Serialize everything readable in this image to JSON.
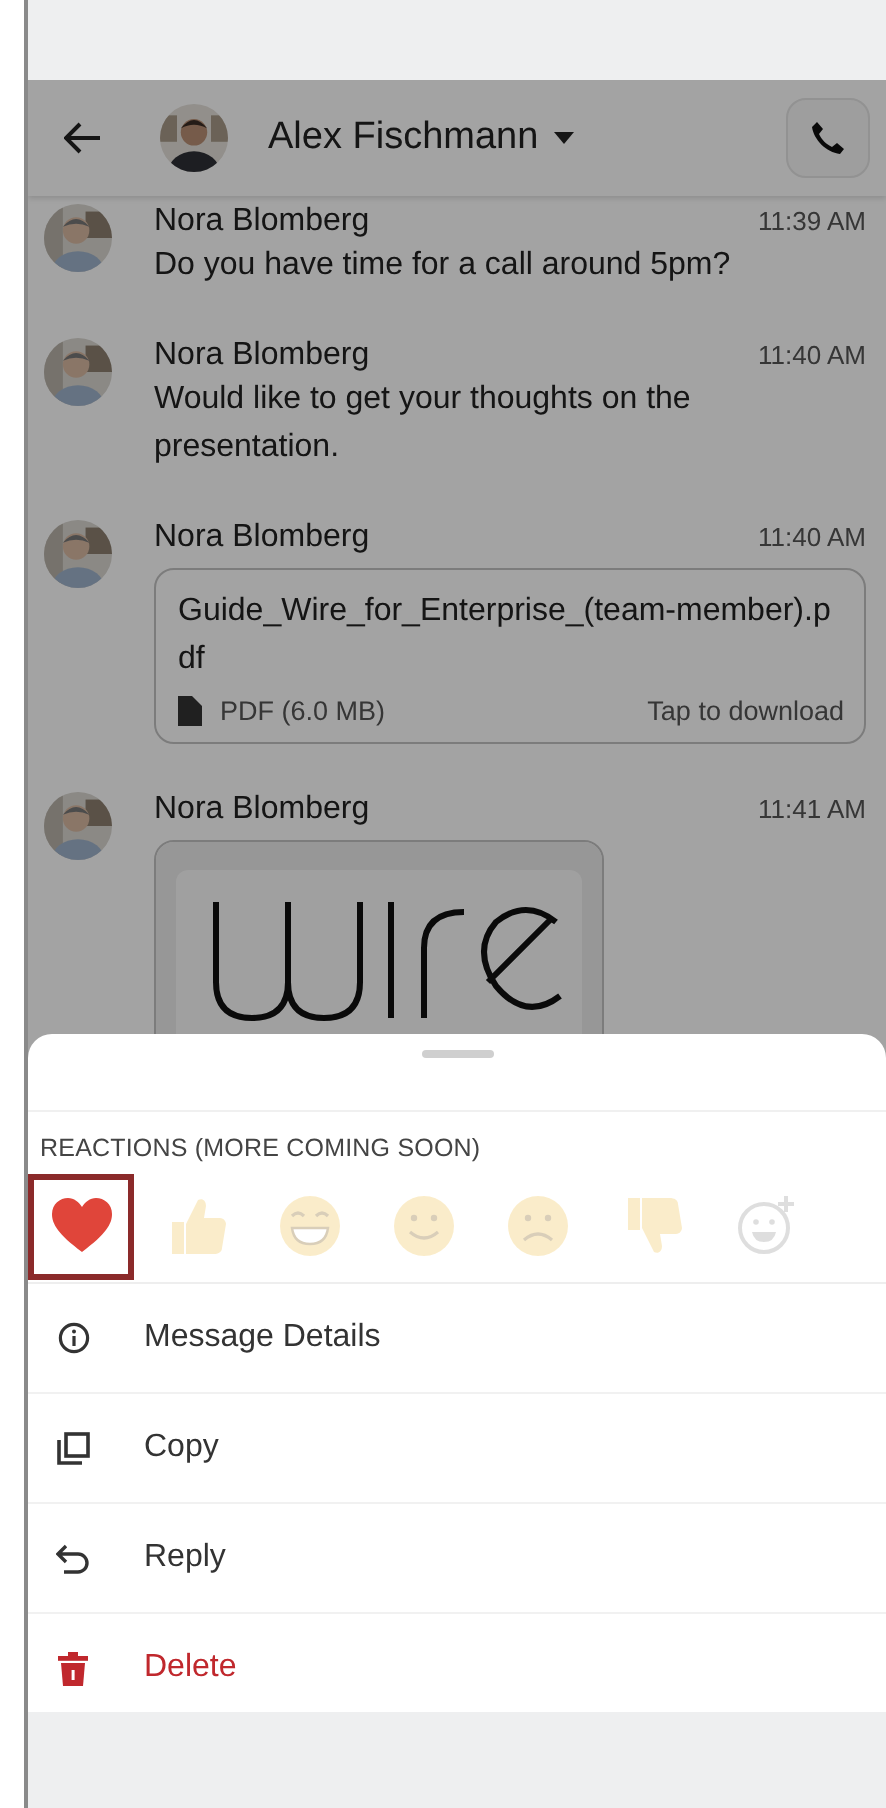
{
  "header": {
    "title": "Alex Fischmann"
  },
  "messages": [
    {
      "kind": "text",
      "sender": "Nora Blomberg",
      "time": "11:39 AM",
      "text": "Do you have time for a call around 5pm?"
    },
    {
      "kind": "text",
      "sender": "Nora Blomberg",
      "time": "11:40 AM",
      "text": "Would like to get your thoughts on the presentation."
    },
    {
      "kind": "file",
      "sender": "Nora Blomberg",
      "time": "11:40 AM",
      "file_name": "Guide_Wire_for_Enterprise_(team-member).pdf",
      "file_info": "PDF (6.0 MB)",
      "action": "Tap to download"
    },
    {
      "sender": "Nora Blomberg",
      "time": "11:41 AM"
    }
  ],
  "sheet": {
    "reactions_label": "REACTIONS (MORE COMING SOON)",
    "reactions": [
      {
        "kind": "heart",
        "selected": true
      },
      {
        "kind": "thumbs-up",
        "selected": false
      },
      {
        "kind": "grin",
        "selected": false
      },
      {
        "kind": "smile",
        "selected": false
      },
      {
        "kind": "frown",
        "selected": false
      },
      {
        "kind": "thumbs-down",
        "selected": false
      },
      {
        "kind": "add",
        "selected": false
      }
    ],
    "actions": [
      {
        "kind": "info",
        "label": "Message Details"
      },
      {
        "kind": "copy",
        "label": "Copy"
      },
      {
        "kind": "reply",
        "label": "Reply"
      },
      {
        "kind": "delete",
        "label": "Delete"
      }
    ]
  }
}
